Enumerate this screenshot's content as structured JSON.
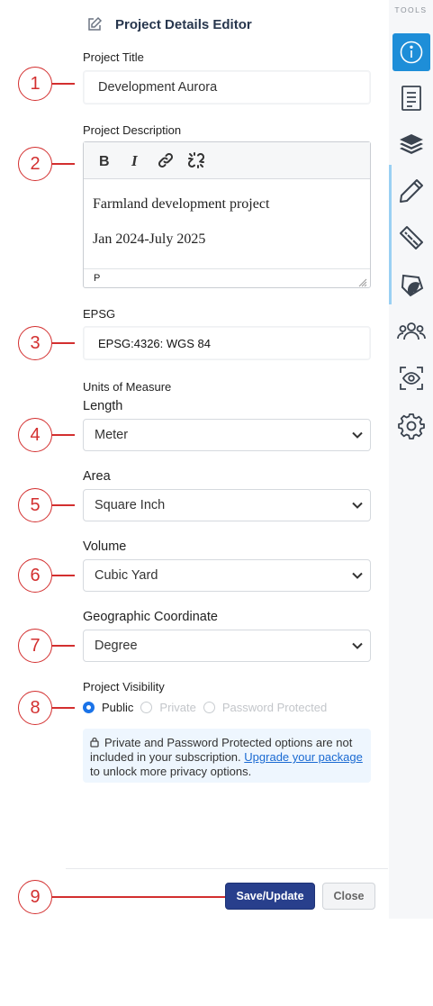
{
  "header": {
    "title": "Project Details Editor",
    "icon": "edit-icon"
  },
  "project_title": {
    "label": "Project Title",
    "value": "Development Aurora"
  },
  "project_description": {
    "label": "Project Description",
    "toolbar": [
      "bold-icon",
      "italic-icon",
      "link-icon",
      "unlink-icon"
    ],
    "paragraphs": [
      "Farmland development project",
      "Jan 2024-July 2025"
    ],
    "status_path": "P"
  },
  "epsg": {
    "label": "EPSG",
    "value": "EPSG:4326: WGS 84"
  },
  "units": {
    "label": "Units of Measure",
    "length": {
      "label": "Length",
      "value": "Meter"
    },
    "area": {
      "label": "Area",
      "value": "Square Inch"
    },
    "volume": {
      "label": "Volume",
      "value": "Cubic Yard"
    },
    "coordinate": {
      "label": "Geographic Coordinate",
      "value": "Degree"
    }
  },
  "visibility": {
    "label": "Project Visibility",
    "options": [
      {
        "label": "Public",
        "selected": true,
        "enabled": true
      },
      {
        "label": "Private",
        "selected": false,
        "enabled": false
      },
      {
        "label": "Password Protected",
        "selected": false,
        "enabled": false
      }
    ],
    "notice_text": "Private and Password Protected options are not included in your subscription.",
    "notice_link": "Upgrade your package",
    "notice_suffix": "to unlock more privacy options."
  },
  "footer": {
    "save_label": "Save/Update",
    "close_label": "Close"
  },
  "callouts": [
    "1",
    "2",
    "3",
    "4",
    "5",
    "6",
    "7",
    "8",
    "9"
  ],
  "rail": {
    "title": "TOOLS",
    "tools": [
      "info-icon",
      "document-icon",
      "layers-icon",
      "pencil-icon",
      "ruler-icon",
      "shape-icon",
      "users-icon",
      "eye-scan-icon",
      "gear-icon"
    ],
    "accent": "#1e8ed8"
  },
  "colors": {
    "callout": "#d32f2f",
    "primary_button": "#283f8c",
    "link": "#1a6ad2",
    "notice_bg": "#eef6fe"
  }
}
